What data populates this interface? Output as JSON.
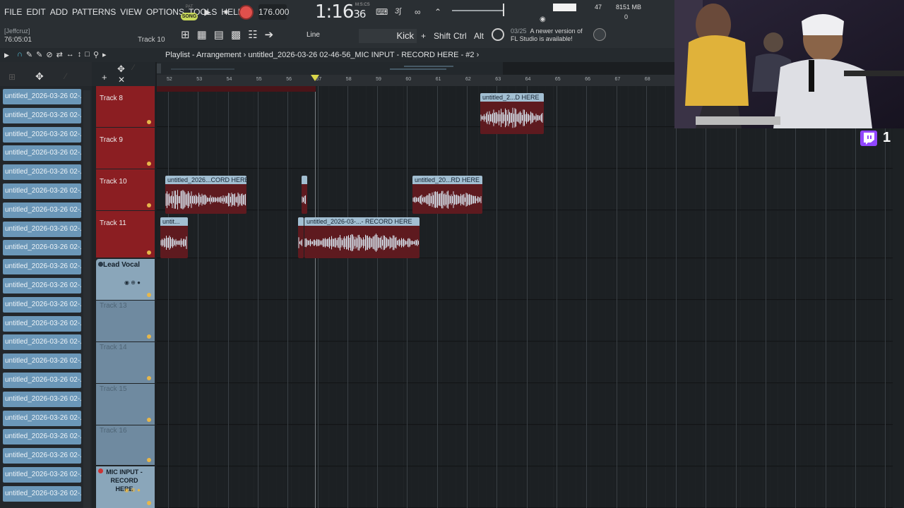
{
  "menu": [
    "FILE",
    "EDIT",
    "ADD",
    "PATTERNS",
    "VIEW",
    "OPTIONS",
    "TOOLS",
    "HELP"
  ],
  "transport": {
    "pat_label": "PAT",
    "song_label": "SONG",
    "tempo": "176.000",
    "time_main": "1:16",
    "time_sub": "36",
    "time_unit": "M:S:CS"
  },
  "monitor": {
    "cpu": "47",
    "memory": "8151 MB",
    "polyphony": "0"
  },
  "user": {
    "name": "[Jeffcruz]",
    "session_time": "76:05:01"
  },
  "hint_track": "Track 10",
  "snap": {
    "line_label": "Line",
    "instrument": "Kick"
  },
  "modifiers": [
    "Shift",
    "Ctrl",
    "Alt"
  ],
  "news": {
    "date": "03/25",
    "line1": "A newer version of",
    "line2": "FL Studio is available!"
  },
  "playlist": {
    "title": "Playlist - Arrangement › untitled_2026-03-26 02-46-56_MIC INPUT - RECORD HERE - #2 ›"
  },
  "browser_items": [
    "untitled_2026-03-26 02-...",
    "untitled_2026-03-26 02-...",
    "untitled_2026-03-26 02-...",
    "untitled_2026-03-26 02-...",
    "untitled_2026-03-26 02-...",
    "untitled_2026-03-26 02-...",
    "untitled_2026-03-26 02-...",
    "untitled_2026-03-26 02-...",
    "untitled_2026-03-26 02-...",
    "untitled_2026-03-26 02-...",
    "untitled_2026-03-26 02-...",
    "untitled_2026-03-26 02-...",
    "untitled_2026-03-26 02-...",
    "untitled_2026-03-26 02-...",
    "untitled_2026-03-26 02-...",
    "untitled_2026-03-26 02-...",
    "untitled_2026-03-26 02-...",
    "untitled_2026-03-26 02-...",
    "untitled_2026-03-26 02-...",
    "untitled_2026-03-26 02-...",
    "untitled_2026-03-26 02-...",
    "untitled_2026-03-26 02-..."
  ],
  "tracks": [
    {
      "name": "Track 8"
    },
    {
      "name": "Track 9"
    },
    {
      "name": "Track 10"
    },
    {
      "name": "Track 11"
    },
    {
      "name": "Lead Vocal"
    },
    {
      "name": "Track 13"
    },
    {
      "name": "Track 14"
    },
    {
      "name": "Track 15"
    },
    {
      "name": "Track 16"
    },
    {
      "name": "MIC INPUT - RECORD HERE"
    }
  ],
  "bars": [
    "52",
    "53",
    "54",
    "55",
    "56",
    "57",
    "58",
    "59",
    "60",
    "61",
    "62",
    "63",
    "64",
    "65",
    "66",
    "67",
    "68"
  ],
  "clips": {
    "t8_a": "untitled_2...D HERE",
    "t10_a": "untitled_2026...CORD HERE",
    "t10_c": "untitled_20...RD HERE",
    "t11_a": "untit...",
    "t11_c": "untitled_2026-03-...- RECORD HERE"
  },
  "twitch": {
    "count": "1"
  },
  "colors": {
    "accent_red": "#8b1e22",
    "clip_title": "#a2bfd2",
    "browser_item": "#6b97b8",
    "record": "#e0504c"
  }
}
